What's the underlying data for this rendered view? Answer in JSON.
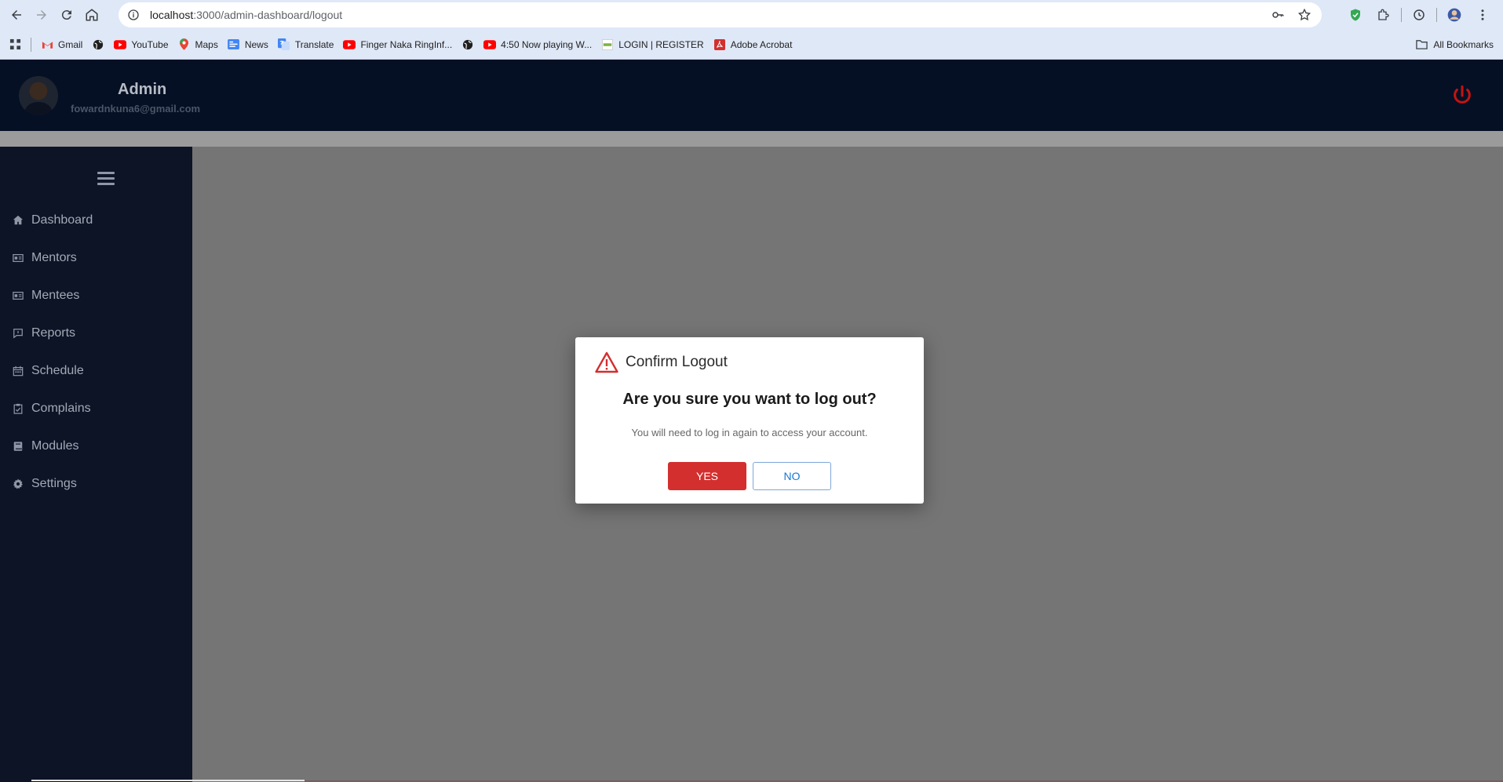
{
  "browser": {
    "url_host": "localhost",
    "url_path": ":3000/admin-dashboard/logout",
    "bookmarks": [
      {
        "label": "Gmail",
        "icon": "gmail-icon",
        "color": "#ea4335"
      },
      {
        "label": "",
        "icon": "globe-icon",
        "color": "#1f1f1f"
      },
      {
        "label": "YouTube",
        "icon": "youtube-icon",
        "color": "#ff0000"
      },
      {
        "label": "Maps",
        "icon": "maps-icon",
        "color": "#34a853"
      },
      {
        "label": "News",
        "icon": "news-icon",
        "color": "#4285f4"
      },
      {
        "label": "Translate",
        "icon": "translate-icon",
        "color": "#4285f4"
      },
      {
        "label": "Finger Naka RingInf...",
        "icon": "youtube-icon",
        "color": "#ff0000"
      },
      {
        "label": "",
        "icon": "globe-icon",
        "color": "#1f1f1f"
      },
      {
        "label": "4:50 Now playing W...",
        "icon": "youtube-icon",
        "color": "#ff0000"
      },
      {
        "label": "LOGIN | REGISTER",
        "icon": "site-icon",
        "color": "#7cb342"
      },
      {
        "label": "Adobe Acrobat",
        "icon": "acrobat-icon",
        "color": "#d32f2f"
      }
    ],
    "all_bookmarks": "All Bookmarks"
  },
  "header": {
    "name": "Admin",
    "email": "fowardnkuna6@gmail.com"
  },
  "sidebar": {
    "items": [
      {
        "label": "Dashboard",
        "icon": "home-icon"
      },
      {
        "label": "Mentors",
        "icon": "id-card-icon"
      },
      {
        "label": "Mentees",
        "icon": "id-card-icon"
      },
      {
        "label": "Reports",
        "icon": "comment-icon"
      },
      {
        "label": "Schedule",
        "icon": "calendar-icon"
      },
      {
        "label": "Complains",
        "icon": "clipboard-check-icon"
      },
      {
        "label": "Modules",
        "icon": "book-icon"
      },
      {
        "label": "Settings",
        "icon": "gear-icon"
      }
    ]
  },
  "dialog": {
    "title": "Confirm Logout",
    "question": "Are you sure you want to log out?",
    "message": "You will need to log in again to access your account.",
    "yes_label": "YES",
    "no_label": "NO"
  },
  "colors": {
    "header_bg": "#051024",
    "sidebar_bg": "#0c1426",
    "overlay": "#757575",
    "danger": "#d32f2f",
    "primary": "#1976d2"
  }
}
